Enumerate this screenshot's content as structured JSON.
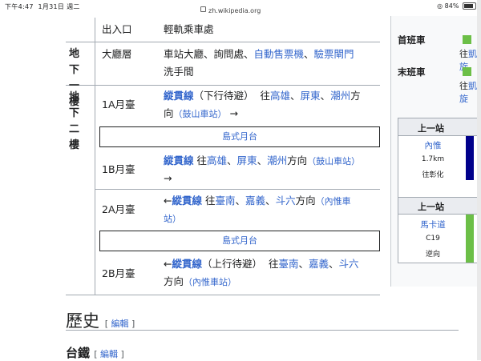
{
  "status_bar": {
    "time": "下午4:47",
    "date": "1月31日 週二",
    "url": "zh.wikipedia.org",
    "battery": "84%",
    "battery_level": 0.84
  },
  "table": {
    "top_row": {
      "col1": "出入口",
      "col2": "輕軌乘車處"
    },
    "b1": {
      "floor": [
        "地下",
        "一樓"
      ],
      "area": "大廳層",
      "line1_prefix": "車站大廳、詢問處、",
      "link_ticket": "自動售票機",
      "sep": "、",
      "link_gate": "驗票閘門",
      "line2": "洗手間"
    },
    "b2": {
      "floor": [
        "地下",
        "二樓"
      ],
      "p1a": {
        "label": "1A月臺",
        "line": "縱貫線",
        "mid": "（下行待避）",
        "to": "往",
        "dests": [
          "高雄",
          "屏東",
          "潮州"
        ],
        "dir": "方",
        "dir2": "向",
        "station": "（鼓山車站）",
        "arrow": "→"
      },
      "island1": "島式月台",
      "p1b": {
        "label": "1B月臺",
        "line": "縱貫線",
        "to": "往",
        "dests": [
          "高雄",
          "屏東",
          "潮州"
        ],
        "dir": "方向",
        "station": "（鼓山車站）",
        "arrow": "→"
      },
      "p2a": {
        "label": "2A月臺",
        "arrow": "←",
        "line": "縱貫線",
        "to": "往",
        "dests": [
          "臺南",
          "嘉義",
          "斗六"
        ],
        "dir": "方向",
        "station1": "（內惟車",
        "station2": "站）"
      },
      "island2": "島式月台",
      "p2b": {
        "label": "2B月臺",
        "arrow": "←",
        "line": "縱貫線",
        "mid": "（上行待避）",
        "to": "往",
        "dests": [
          "臺南",
          "嘉義",
          "斗六"
        ],
        "dir": "方向",
        "station": "（內惟車站）"
      }
    },
    "sep": "、"
  },
  "history": {
    "title": "歷史",
    "edit_open": "[",
    "edit": "編輯",
    "edit_close": "]"
  },
  "rail": {
    "title": "台鐵",
    "edit_open": "[",
    "edit": "編輯",
    "edit_close": "]"
  },
  "sidebar": {
    "first_train": "首班車",
    "first_to": "往",
    "first_dest": "凱旋",
    "last_train": "末班車",
    "last_to": "往",
    "last_dest": "凱旋",
    "card1": {
      "header": "上一站",
      "name": "內惟",
      "distance": "1.7km",
      "dir": "往彰化"
    },
    "card2": {
      "header": "上一站",
      "name": "馬卡道",
      "code": "C19",
      "dir": "逆向"
    },
    "colors": {
      "tra": "#00008b",
      "lrt": "#6cbf47"
    }
  }
}
